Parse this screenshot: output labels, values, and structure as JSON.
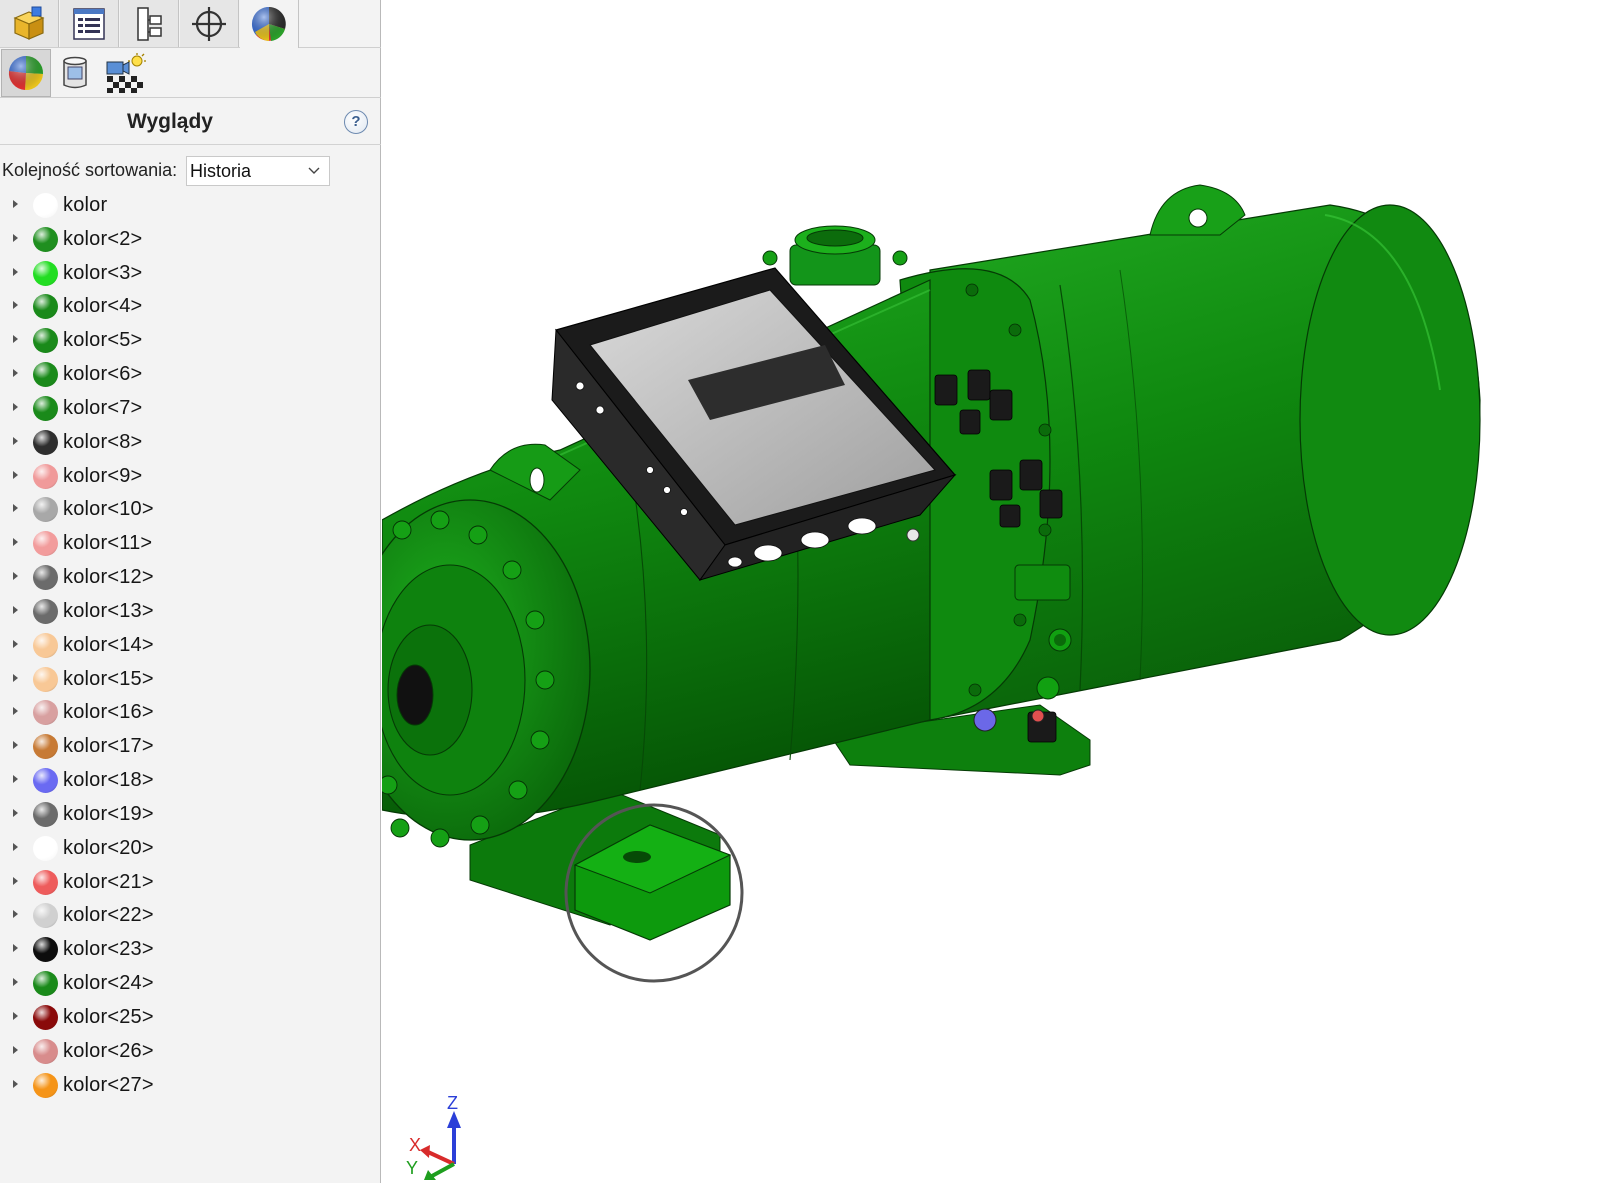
{
  "tabs": [
    {
      "name": "feature-manager",
      "icon": "feature-manager-icon"
    },
    {
      "name": "property-manager",
      "icon": "property-manager-icon"
    },
    {
      "name": "configuration-manager",
      "icon": "configuration-manager-icon"
    },
    {
      "name": "dimxpert-manager",
      "icon": "crosshair-icon"
    },
    {
      "name": "display-manager",
      "icon": "display-manager-icon",
      "active": true
    }
  ],
  "subtabs": [
    {
      "name": "appearances",
      "icon": "appearances-icon",
      "active": true
    },
    {
      "name": "decals",
      "icon": "decals-icon"
    },
    {
      "name": "scene-lights-cameras",
      "icon": "scene-lights-icon"
    }
  ],
  "panel": {
    "title": "Wyglądy",
    "help_label": "?",
    "sort_label": "Kolejność sortowania:",
    "sort_value": "Historia"
  },
  "colors": [
    {
      "label": "kolor",
      "color": "#ffffff"
    },
    {
      "label": "kolor<2>",
      "color": "#1f8f1f"
    },
    {
      "label": "kolor<3>",
      "color": "#22dd22"
    },
    {
      "label": "kolor<4>",
      "color": "#1a8a1a"
    },
    {
      "label": "kolor<5>",
      "color": "#1a8a1a"
    },
    {
      "label": "kolor<6>",
      "color": "#1a8a1a"
    },
    {
      "label": "kolor<7>",
      "color": "#1a8a1a"
    },
    {
      "label": "kolor<8>",
      "color": "#2e2e2e"
    },
    {
      "label": "kolor<9>",
      "color": "#f09a9a"
    },
    {
      "label": "kolor<10>",
      "color": "#a8a8a8"
    },
    {
      "label": "kolor<11>",
      "color": "#f29c9c"
    },
    {
      "label": "kolor<12>",
      "color": "#6b6b6b"
    },
    {
      "label": "kolor<13>",
      "color": "#6b6b6b"
    },
    {
      "label": "kolor<14>",
      "color": "#f8c896"
    },
    {
      "label": "kolor<15>",
      "color": "#f8c896"
    },
    {
      "label": "kolor<16>",
      "color": "#d8a0a0"
    },
    {
      "label": "kolor<17>",
      "color": "#c77a35"
    },
    {
      "label": "kolor<18>",
      "color": "#6a6af2"
    },
    {
      "label": "kolor<19>",
      "color": "#6b6b6b"
    },
    {
      "label": "kolor<20>",
      "color": "#ffffff"
    },
    {
      "label": "kolor<21>",
      "color": "#ee5c5c"
    },
    {
      "label": "kolor<22>",
      "color": "#d0d0d0"
    },
    {
      "label": "kolor<23>",
      "color": "#0d0d0d"
    },
    {
      "label": "kolor<24>",
      "color": "#1a8a1a"
    },
    {
      "label": "kolor<25>",
      "color": "#8a0a0a"
    },
    {
      "label": "kolor<26>",
      "color": "#d88c8c"
    },
    {
      "label": "kolor<27>",
      "color": "#f59418"
    }
  ],
  "triad": {
    "x_label": "X",
    "y_label": "Y",
    "z_label": "Z"
  },
  "accent_green": "#118811"
}
